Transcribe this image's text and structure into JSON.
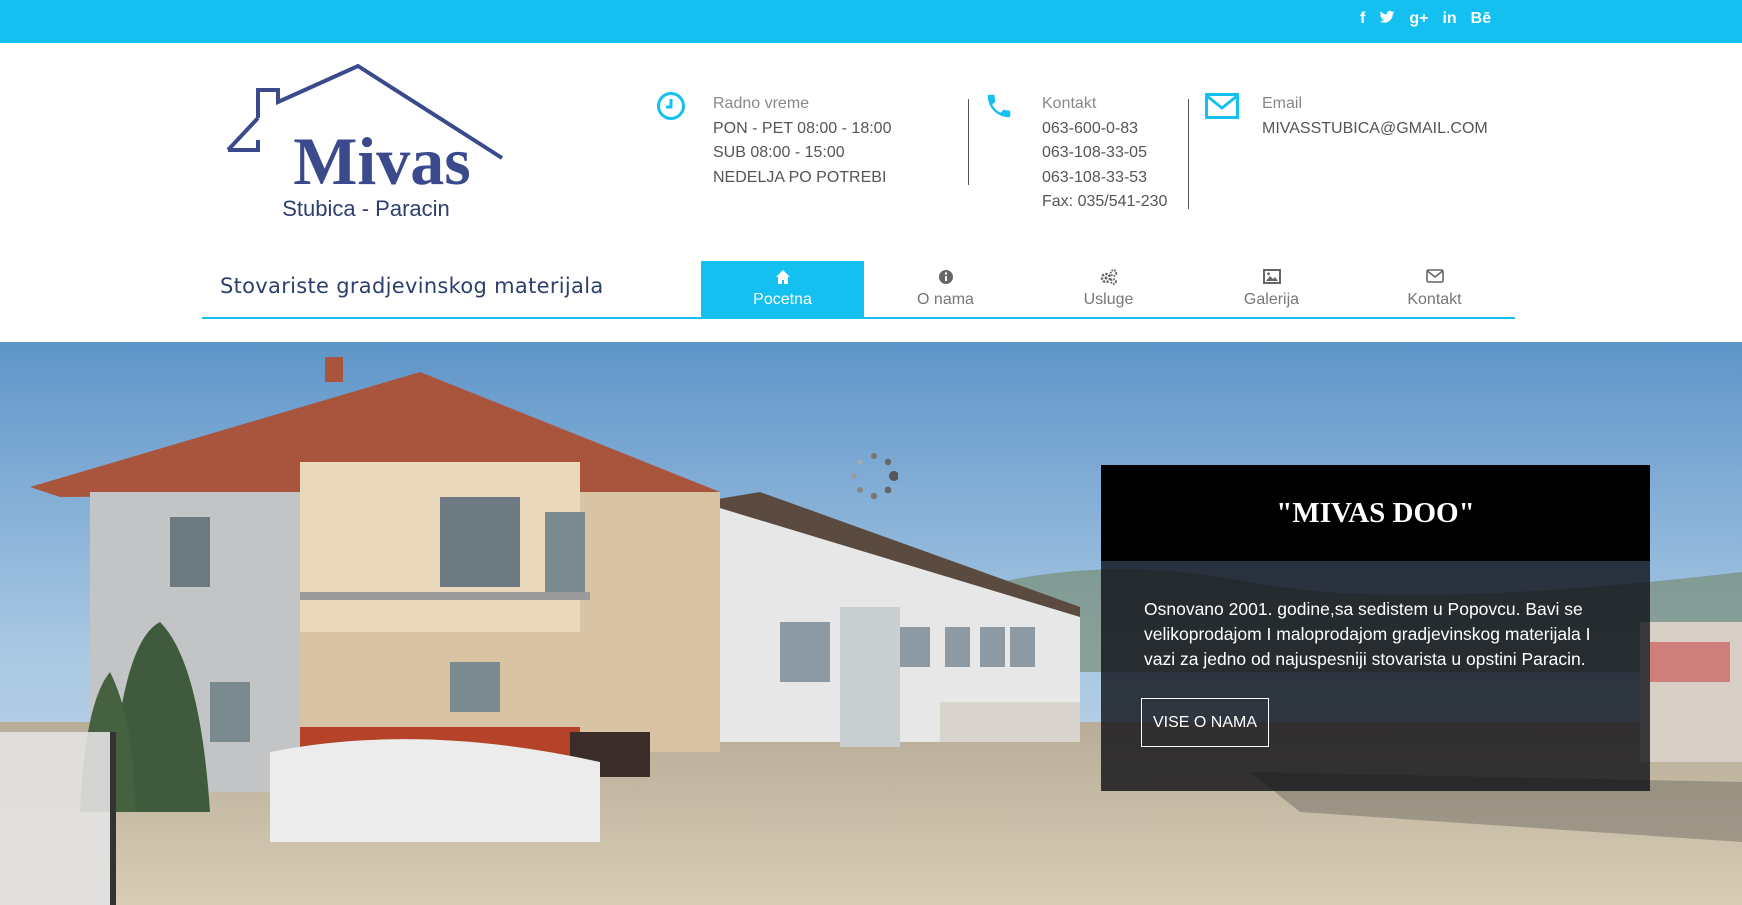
{
  "social": [
    {
      "name": "facebook-icon",
      "glyph": "f"
    },
    {
      "name": "twitter-icon",
      "glyph": "t"
    },
    {
      "name": "google-plus-icon",
      "glyph": "g+"
    },
    {
      "name": "linkedin-icon",
      "glyph": "in"
    },
    {
      "name": "behance-icon",
      "glyph": "Bē"
    }
  ],
  "logo": {
    "name": "Mivas",
    "sub": "Stubica - Paracin"
  },
  "hours": {
    "label": "Radno vreme",
    "lines": [
      "PON - PET  08:00 - 18:00",
      "SUB  08:00 - 15:00",
      "NEDELJA PO POTREBI"
    ]
  },
  "contact": {
    "label": "Kontakt",
    "lines": [
      "063-600-0-83",
      "063-108-33-05",
      "063-108-33-53",
      "Fax: 035/541-230"
    ]
  },
  "email": {
    "label": "Email",
    "value": "MIVASSTUBICA@GMAIL.COM"
  },
  "tagline": "Stovariste gradjevinskog materijala",
  "nav": [
    {
      "label": "Pocetna",
      "icon": "home-icon"
    },
    {
      "label": "O nama",
      "icon": "info-icon"
    },
    {
      "label": "Usluge",
      "icon": "gears-icon"
    },
    {
      "label": "Galerija",
      "icon": "image-icon"
    },
    {
      "label": "Kontakt",
      "icon": "envelope-icon"
    }
  ],
  "slide": {
    "title": "\"MIVAS DOO\"",
    "text": "Osnovano 2001. godine,sa sedistem u Popovcu. Bavi se velikoprodajom I maloprodajom gradjevinskog materijala I vazi za jedno od najuspesniji stovarista u opstini Paracin.",
    "button": "VISE O NAMA"
  },
  "colors": {
    "accent": "#14c0ef",
    "brand": "#3a4a8c"
  }
}
